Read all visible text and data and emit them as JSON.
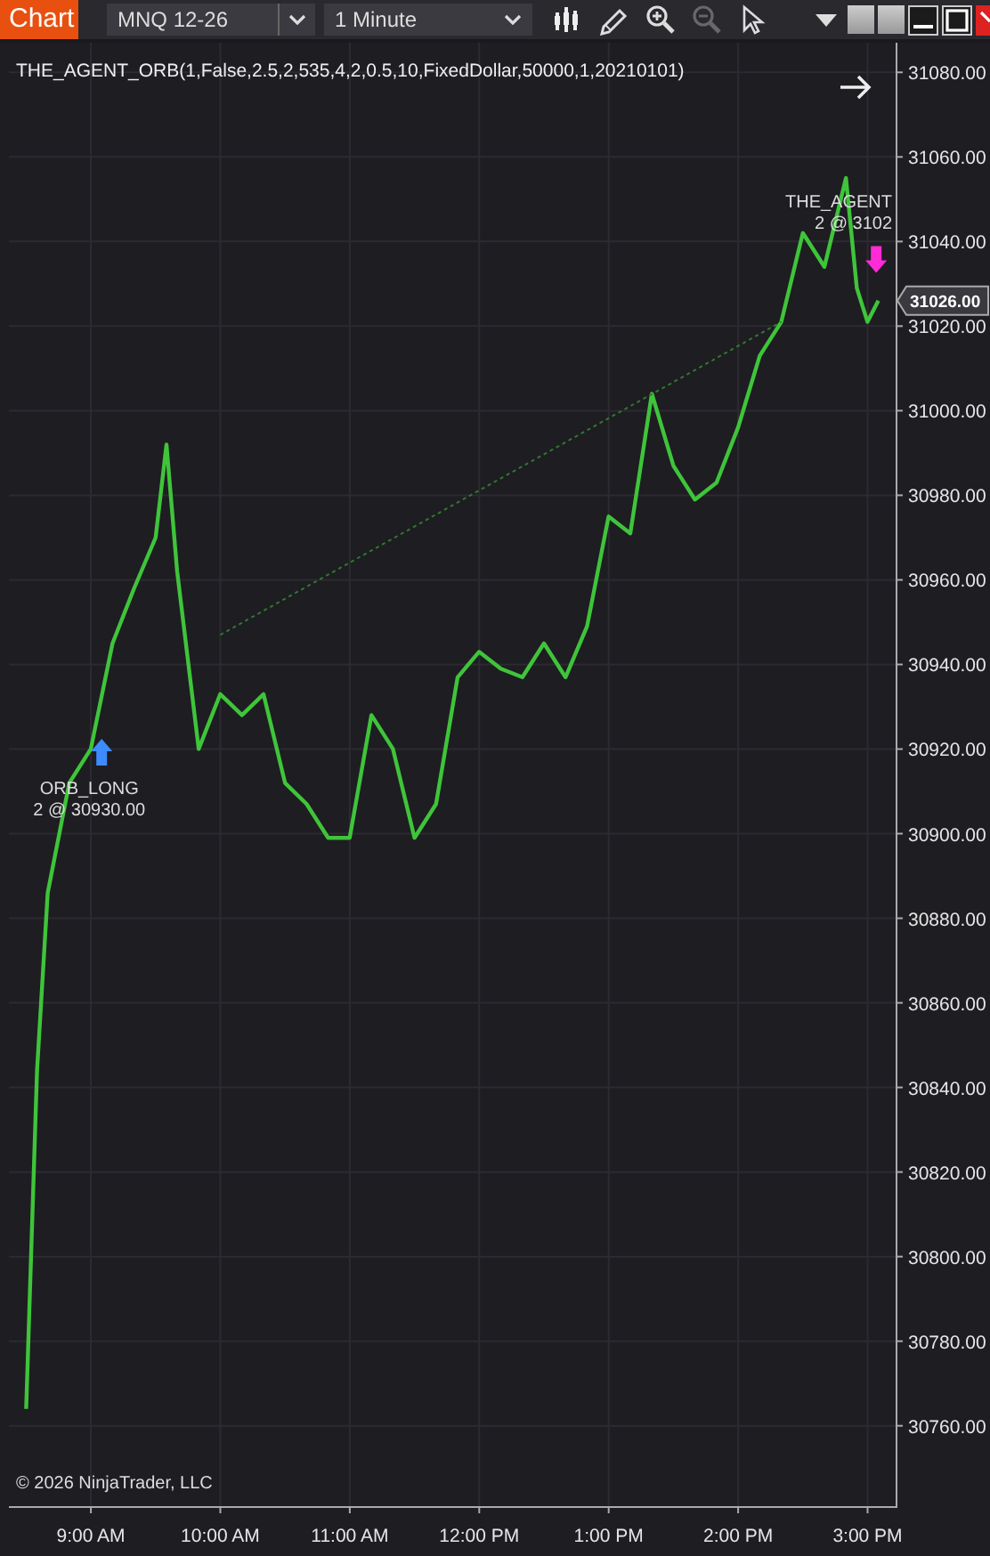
{
  "tab": {
    "label": "Chart"
  },
  "instrument": {
    "value": "MNQ 12-26"
  },
  "interval": {
    "value": "1 Minute"
  },
  "toolbar": [
    {
      "kind": "bars",
      "disabled": false
    },
    {
      "kind": "pencil",
      "disabled": false
    },
    {
      "kind": "zoom-in",
      "disabled": false
    },
    {
      "kind": "zoom-out",
      "disabled": true
    },
    {
      "kind": "pointer",
      "disabled": false
    }
  ],
  "indicator_label": "THE_AGENT_ORB(1,False,2.5,2,535,4,2,0.5,10,FixedDollar,50000,1,20210101)",
  "copyright": "© 2026 NinjaTrader, LLC",
  "last_price": "31026.00",
  "chart_data": {
    "type": "line",
    "x": [
      510,
      515,
      520,
      530,
      540,
      550,
      560,
      570,
      575,
      580,
      590,
      600,
      610,
      620,
      630,
      640,
      650,
      660,
      670,
      680,
      690,
      700,
      710,
      720,
      730,
      740,
      750,
      760,
      770,
      780,
      790,
      800,
      810,
      820,
      830,
      840,
      850,
      860,
      870,
      880,
      890,
      895,
      900,
      905
    ],
    "series": [
      {
        "color": "#3fc43a",
        "line_style": "solid",
        "values": [
          30764,
          30844,
          30886,
          30912,
          30920,
          30945,
          30958,
          30970,
          30992,
          30962,
          30920,
          30933,
          30928,
          30933,
          30912,
          30907,
          30899,
          30899,
          30928,
          30920,
          30899,
          30907,
          30937,
          30943,
          30939,
          30937,
          30945,
          30937,
          30949,
          30975,
          30971,
          31004,
          30987,
          30979,
          30983,
          30996,
          31013,
          31021,
          31042,
          31034,
          31055,
          31029,
          31021,
          31026
        ]
      },
      {
        "color": "#2f7a2f",
        "line_style": "dashed",
        "values": [
          null,
          null,
          null,
          null,
          null,
          null,
          null,
          null,
          null,
          null,
          null,
          30947,
          null,
          null,
          null,
          null,
          null,
          null,
          null,
          null,
          null,
          null,
          null,
          null,
          null,
          null,
          null,
          null,
          null,
          null,
          null,
          null,
          null,
          null,
          null,
          null,
          null,
          31021,
          null,
          null,
          null,
          null,
          null,
          null
        ]
      }
    ],
    "grid": true,
    "xlim": [
      502,
      913
    ],
    "ylim": [
      30741,
      31087
    ],
    "xticks": [
      {
        "value": 540,
        "label": "9:00 AM"
      },
      {
        "value": 600,
        "label": "10:00 AM"
      },
      {
        "value": 660,
        "label": "11:00 AM"
      },
      {
        "value": 720,
        "label": "12:00 PM"
      },
      {
        "value": 780,
        "label": "1:00 PM"
      },
      {
        "value": 840,
        "label": "2:00 PM"
      },
      {
        "value": 900,
        "label": "3:00 PM"
      }
    ],
    "yticks": [
      {
        "value": 30760,
        "label": "30760.00"
      },
      {
        "value": 30780,
        "label": "30780.00"
      },
      {
        "value": 30800,
        "label": "30800.00"
      },
      {
        "value": 30820,
        "label": "30820.00"
      },
      {
        "value": 30840,
        "label": "30840.00"
      },
      {
        "value": 30860,
        "label": "30860.00"
      },
      {
        "value": 30880,
        "label": "30880.00"
      },
      {
        "value": 30900,
        "label": "30900.00"
      },
      {
        "value": 30920,
        "label": "30920.00"
      },
      {
        "value": 30940,
        "label": "30940.00"
      },
      {
        "value": 30960,
        "label": "30960.00"
      },
      {
        "value": 30980,
        "label": "30980.00"
      },
      {
        "value": 31000,
        "label": "31000.00"
      },
      {
        "value": 31020,
        "label": "31020.00"
      },
      {
        "value": 31040,
        "label": "31040.00"
      },
      {
        "value": 31060,
        "label": "31060.00"
      },
      {
        "value": 31080,
        "label": "31080.00"
      }
    ],
    "annotations": [
      "ORB_LONG",
      "2 @ 30930.00",
      "THE_AGENT",
      "2 @ 3102"
    ]
  }
}
